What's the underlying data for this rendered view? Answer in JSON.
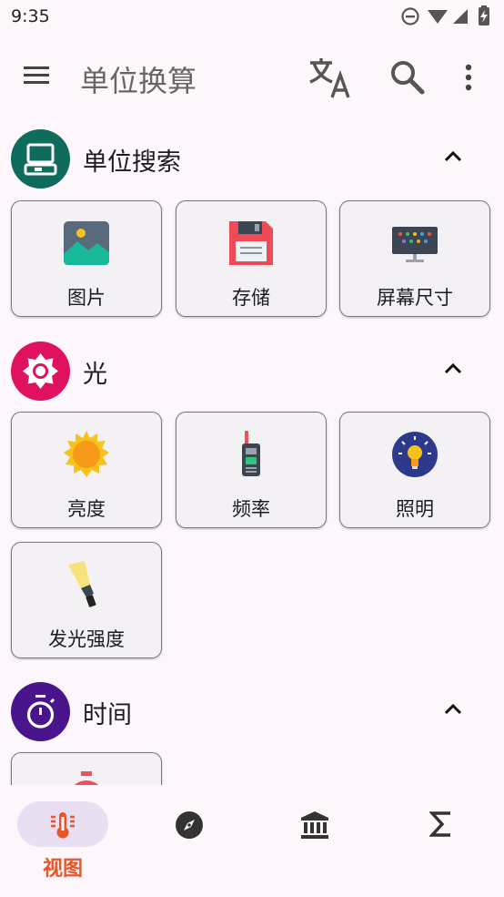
{
  "status_bar": {
    "time": "9:35"
  },
  "app_bar": {
    "title": "单位换算"
  },
  "sections": [
    {
      "name": "单位搜索",
      "tiles": [
        "图片",
        "存储",
        "屏幕尺寸"
      ]
    },
    {
      "name": "光",
      "tiles": [
        "亮度",
        "频率",
        "照明",
        "发光强度"
      ]
    },
    {
      "name": "时间",
      "tiles": []
    }
  ],
  "bottom_nav": {
    "view_label": "视图"
  },
  "colors": {
    "accent": "#e8562a",
    "section_storage": "#0f6b5c",
    "section_light": "#e0115f",
    "section_time": "#4a148c",
    "nav_active_pill": "#eadff2"
  }
}
